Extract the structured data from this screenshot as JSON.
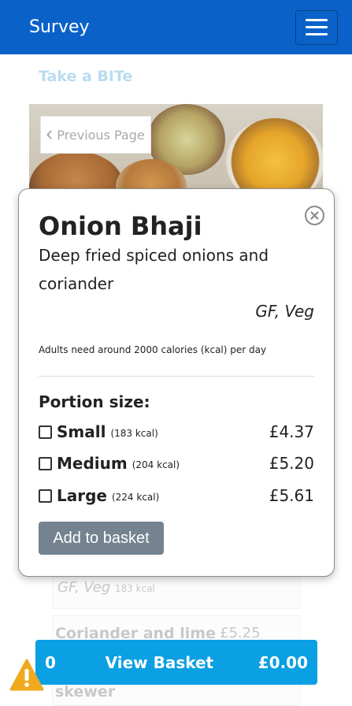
{
  "navbar": {
    "brand": "Survey",
    "menu_icon": "hamburger-icon"
  },
  "page": {
    "subtitle": "Take a BITe",
    "previous_label": "Previous Page",
    "previous_icon": "chevron-left-icon"
  },
  "background_items": {
    "tags_line": "GF, Veg",
    "tags_kcal": "183 kcal",
    "next_item_name": "Coriander and lime",
    "next_item_price": "£5.25",
    "next_item_name_cont": "skewer"
  },
  "modal": {
    "title": "Onion Bhaji",
    "description": "Deep fried spiced onions and coriander",
    "tags": "GF, Veg",
    "calorie_note": "Adults need around 2000 calories (kcal) per day",
    "portion_label": "Portion size:",
    "options": [
      {
        "name": "Small",
        "kcal": "(183 kcal)",
        "price": "£4.37",
        "checked": false
      },
      {
        "name": "Medium",
        "kcal": "(204 kcal)",
        "price": "£5.20",
        "checked": false
      },
      {
        "name": "Large",
        "kcal": "(224 kcal)",
        "price": "£5.61",
        "checked": false
      }
    ],
    "add_label": "Add to basket",
    "close_icon": "close-circle-icon"
  },
  "basket": {
    "count": "0",
    "label": "View Basket",
    "total": "£0.00"
  },
  "colors": {
    "navbar": "#0a62c9",
    "basket": "#0b9fe3",
    "add_button": "#74838f",
    "warning": "#f0a91e"
  },
  "warning_icon": "warning-icon"
}
